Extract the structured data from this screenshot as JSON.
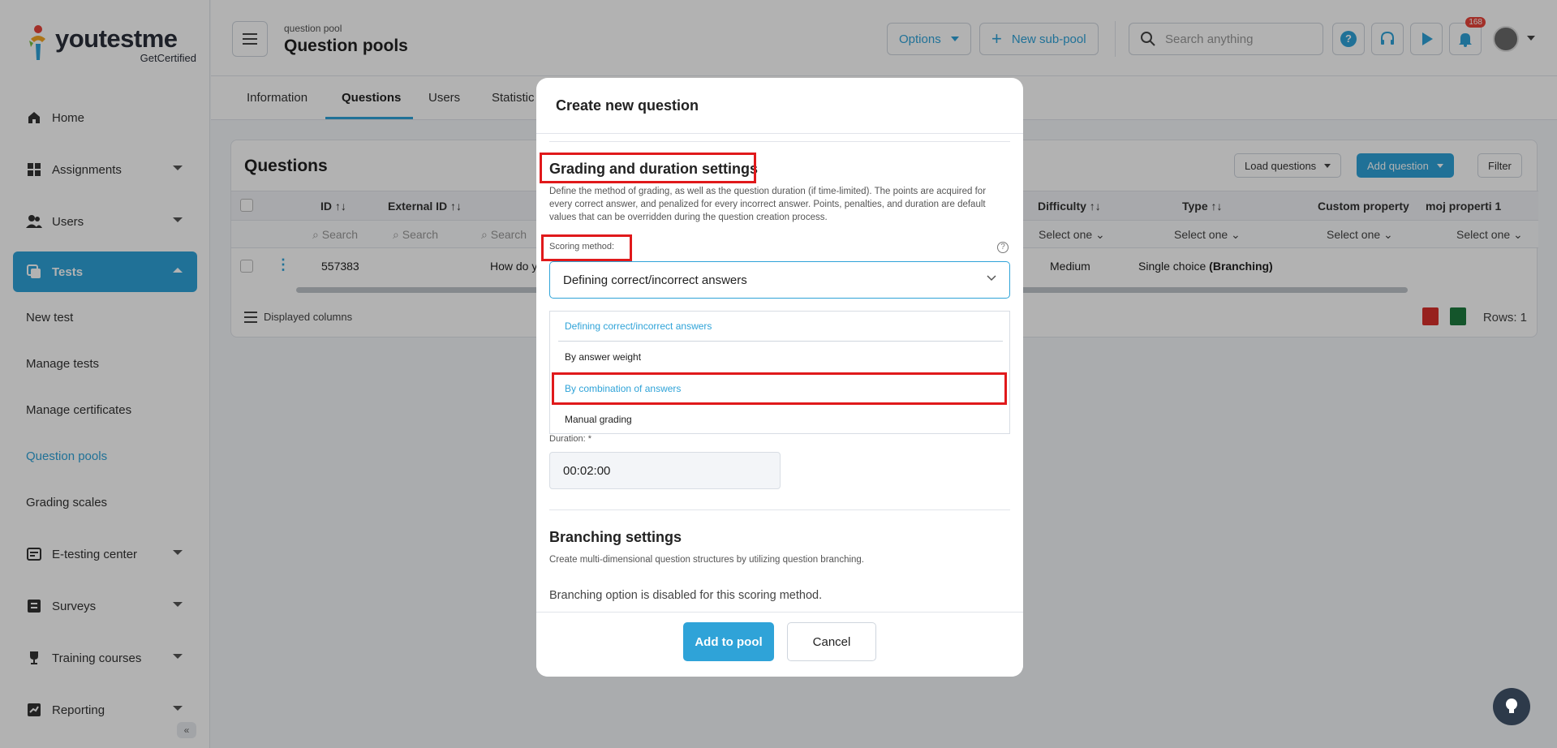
{
  "brand": {
    "name": "youtestme",
    "sub": "GetCertified"
  },
  "sidebar": {
    "items": [
      {
        "label": "Home",
        "icon": "home-icon"
      },
      {
        "label": "Assignments",
        "icon": "assignments-icon"
      },
      {
        "label": "Users",
        "icon": "users-icon"
      },
      {
        "label": "Tests",
        "icon": "tests-icon"
      }
    ],
    "sub_items": [
      "New test",
      "Manage tests",
      "Manage certificates",
      "Question pools",
      "Grading scales"
    ],
    "bottom_items": [
      {
        "label": "E-testing center",
        "icon": "e-testing-icon"
      },
      {
        "label": "Surveys",
        "icon": "surveys-icon"
      },
      {
        "label": "Training courses",
        "icon": "trophy-icon"
      },
      {
        "label": "Reporting",
        "icon": "reporting-icon"
      }
    ],
    "collapse_label": "«"
  },
  "header": {
    "breadcrumb_small": "question pool",
    "title": "Question pools",
    "options_label": "Options",
    "new_subpool_label": "New sub-pool",
    "search_placeholder": "Search anything",
    "notifications_count": "168"
  },
  "tabs": [
    "Information",
    "Questions",
    "Users",
    "Statistic"
  ],
  "questions_card": {
    "title": "Questions",
    "load_label": "Load questions",
    "add_label": "Add question",
    "filter_label": "Filter",
    "columns": [
      "ID",
      "External ID",
      "Difficulty",
      "Type",
      "Custom property",
      "moj properti 1"
    ],
    "search_placeholder": "Search",
    "select_placeholder": "Select one",
    "row": {
      "id": "557383",
      "text": "How do y",
      "difficulty": "Medium",
      "type": "Single choice",
      "type_bold": "(Branching)"
    },
    "displayed_columns": "Displayed columns",
    "rows_label": "Rows: 1"
  },
  "modal": {
    "title": "Create new question",
    "grading_title": "Grading and duration settings",
    "grading_desc": "Define the method of grading, as well as the question duration (if time-limited). The points are acquired for every correct answer, and penalized for every incorrect answer. Points, penalties, and duration are default values that can be overridden during the question creation process.",
    "scoring_label": "Scoring method:",
    "scoring_value": "Defining correct/incorrect answers",
    "options": [
      "Defining correct/incorrect answers",
      "By answer weight",
      "By combination of answers",
      "Manual grading"
    ],
    "duration_label": "Duration: *",
    "duration_value": "00:02:00",
    "branching_title": "Branching settings",
    "branching_desc": "Create multi-dimensional question structures by utilizing question branching.",
    "branching_note": "Branching option is disabled for this scoring method.",
    "add_label": "Add to pool",
    "cancel_label": "Cancel"
  },
  "colors": {
    "accent": "#2fa3d8",
    "highlight": "#e0191b"
  }
}
